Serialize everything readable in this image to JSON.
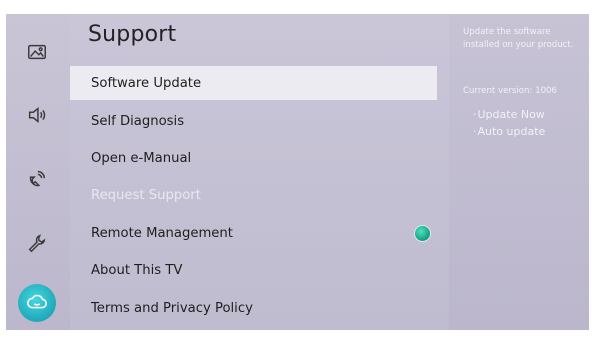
{
  "menu": {
    "title": "Support",
    "items": [
      {
        "label": "Software Update",
        "selected": true
      },
      {
        "label": "Self Diagnosis"
      },
      {
        "label": "Open e-Manual"
      },
      {
        "label": "Request Support",
        "disabled": true
      },
      {
        "label": "Remote Management",
        "toggle": "on"
      },
      {
        "label": "About This TV"
      },
      {
        "label": "Terms and Privacy Policy"
      }
    ]
  },
  "info": {
    "description": "Update the software installed on your product.",
    "version": "Current version: 1006",
    "options": [
      "Update Now",
      "Auto update"
    ]
  },
  "rail": {
    "icons": [
      "picture-icon",
      "sound-icon",
      "broadcasting-icon",
      "general-icon",
      "support-icon"
    ],
    "active": "support-icon",
    "active_color": "#1fa9b9"
  }
}
